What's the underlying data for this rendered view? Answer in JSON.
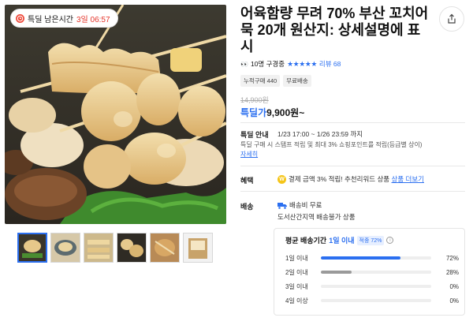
{
  "deal_timer": {
    "label": "특딜 남은시간",
    "time": "3일 06:57"
  },
  "product": {
    "title": "어육함량 무려 70% 부산 꼬치어묵 20개 원산지: 상세설명에 표시",
    "buyers": "10명 구경중",
    "stars": "★★★★★",
    "review_link": "리뷰 68",
    "tags": [
      "누적구매 440",
      "무료배송"
    ],
    "original_price": "14,900원",
    "deal_label": "특딜가",
    "deal_price": "9,900원~"
  },
  "deal_info": {
    "label": "특딜 안내",
    "period": "1/23 17:00 ~ 1/26 23:59 까지",
    "description": "특딜 구매 시 스탬프 적립 및 최대 3% 쇼핑포인트를 적립(등급별 상이)",
    "detail_link": "자세히"
  },
  "benefit": {
    "label": "혜택",
    "badge": "W",
    "text": "결제 금액 3% 적립! 추천리워드 상품",
    "more_link": "상품 더보기"
  },
  "shipping": {
    "label": "배송",
    "fee": "배송비 무료",
    "note": "도서산간지역 배송불가 상품",
    "box": {
      "title_prefix": "평균 배송기간",
      "title_value": "1일 이내",
      "title_badge": "적중 72%",
      "info_icon": "i",
      "rows": [
        {
          "label": "1일 이내",
          "pct": 72,
          "pct_text": "72%"
        },
        {
          "label": "2일 이내",
          "pct": 28,
          "pct_text": "28%"
        },
        {
          "label": "3일 이내",
          "pct": 0,
          "pct_text": "0%"
        },
        {
          "label": "4일 이상",
          "pct": 0,
          "pct_text": "0%"
        }
      ]
    }
  },
  "colors": {
    "accent": "#2b6ff0",
    "bar_primary": "#2b6ff0",
    "bar_secondary": "#9a9a9a",
    "timer": "#e5352b"
  },
  "icons": {
    "timer": "clock-icon",
    "share": "share-icon",
    "delivery": "truck-icon",
    "viewers": "eyes-icon"
  }
}
